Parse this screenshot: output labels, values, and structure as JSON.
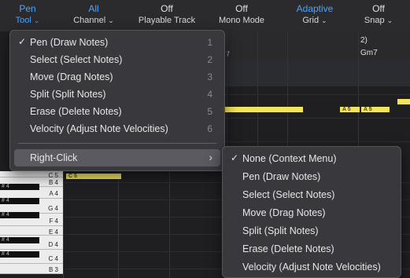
{
  "colors": {
    "accent_blue": "#4aa3ff",
    "note_yellow": "#f2e55b",
    "menu_bg": "#3a3a3e"
  },
  "toolbar": {
    "pen": {
      "top": "Pen",
      "bottom": "Tool"
    },
    "channel": {
      "top": "All",
      "bottom": "Channel"
    },
    "playable": {
      "top": "Off",
      "bottom": "Playable Track"
    },
    "mono": {
      "top": "Off",
      "bottom": "Mono Mode"
    },
    "grid": {
      "top": "Adaptive",
      "bottom": "Grid"
    },
    "snap": {
      "top": "Off",
      "bottom": "Snap"
    }
  },
  "ruler": {
    "bar_number": "2)",
    "chord": "Gm7",
    "partial_label": "7"
  },
  "notes": [
    {
      "label": ""
    },
    {
      "label": "A 5"
    },
    {
      "label": "A 5"
    },
    {
      "label": ""
    },
    {
      "label": "C 5"
    }
  ],
  "keyboard": {
    "white_keys": [
      "C 5",
      "B 4",
      "A 4",
      "G 4",
      "F 4",
      "E 4",
      "D 4",
      "C 4",
      "B 3"
    ],
    "black_keys": [
      "# 4",
      "# 4",
      "# 4",
      "# 4",
      "# 4"
    ]
  },
  "tool_menu": {
    "items": [
      {
        "check": "✓",
        "label": "Pen (Draw Notes)",
        "shortcut": "1"
      },
      {
        "check": "",
        "label": "Select (Select Notes)",
        "shortcut": "2"
      },
      {
        "check": "",
        "label": "Move (Drag Notes)",
        "shortcut": "3"
      },
      {
        "check": "",
        "label": "Split (Split Notes)",
        "shortcut": "4"
      },
      {
        "check": "",
        "label": "Erase (Delete Notes)",
        "shortcut": "5"
      },
      {
        "check": "",
        "label": "Velocity (Adjust Note Velocities)",
        "shortcut": "6"
      }
    ],
    "right_click": {
      "label": "Right-Click",
      "arrow": "›"
    }
  },
  "right_click_menu": {
    "items": [
      {
        "check": "✓",
        "label": "None (Context Menu)"
      },
      {
        "check": "",
        "label": "Pen (Draw Notes)"
      },
      {
        "check": "",
        "label": "Select (Select Notes)"
      },
      {
        "check": "",
        "label": "Move (Drag Notes)"
      },
      {
        "check": "",
        "label": "Split (Split Notes)"
      },
      {
        "check": "",
        "label": "Erase (Delete Notes)"
      },
      {
        "check": "",
        "label": "Velocity (Adjust Note Velocities)"
      }
    ]
  }
}
